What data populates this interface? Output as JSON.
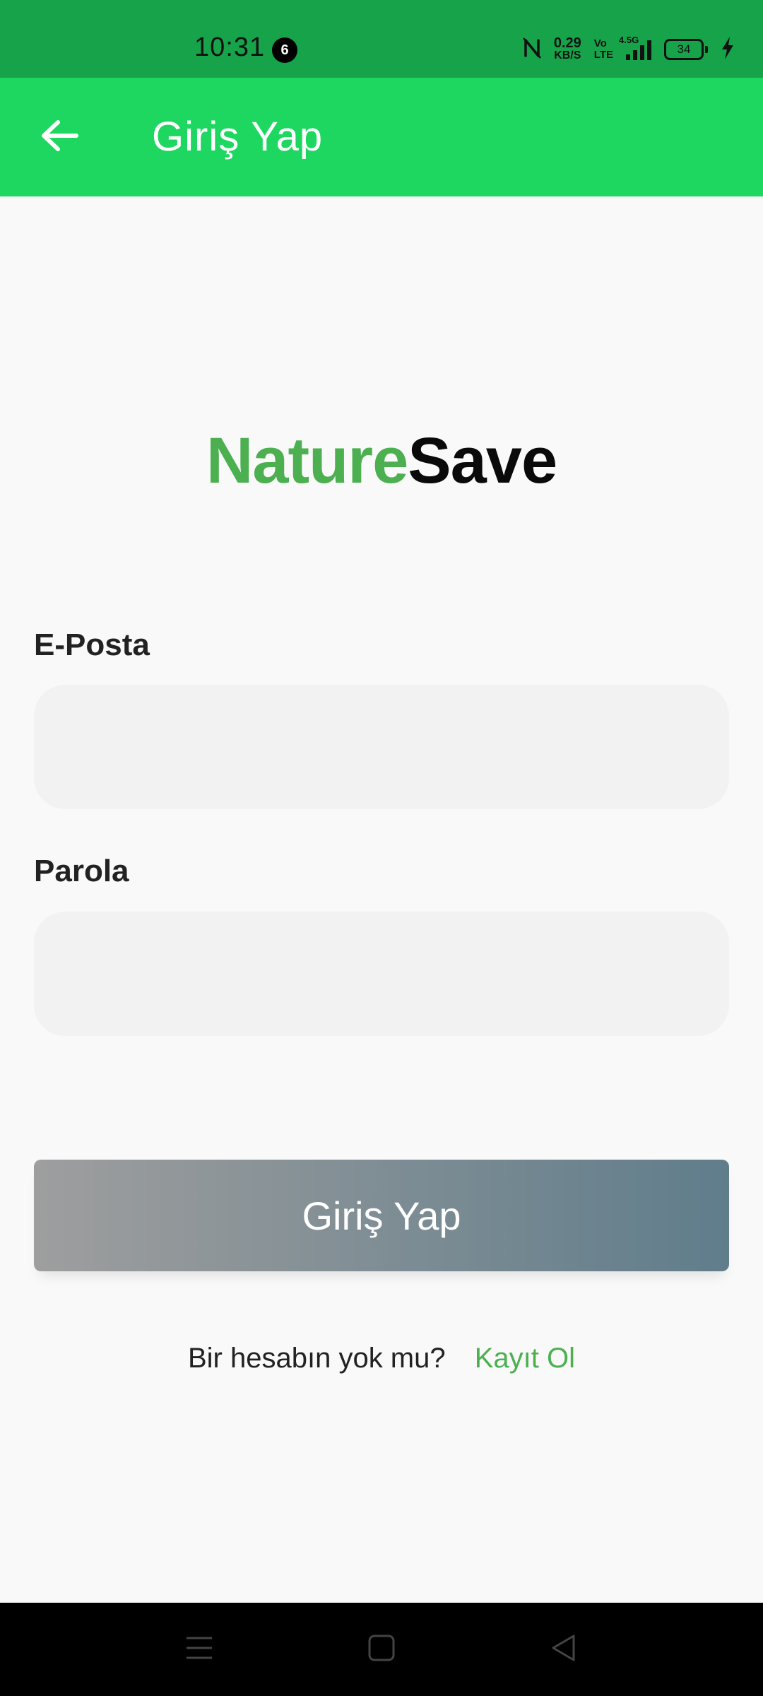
{
  "status_bar": {
    "time": "10:31",
    "notification_count": "6",
    "net_speed_value": "0.29",
    "net_speed_unit": "KB/S",
    "volte_top": "Vo",
    "volte_bottom": "LTE",
    "network_type": "4.5G",
    "battery_level": "34"
  },
  "app_bar": {
    "title": "Giriş Yap"
  },
  "logo": {
    "part1": "Nature",
    "part2": "Save"
  },
  "form": {
    "email_label": "E-Posta",
    "email_value": "",
    "password_label": "Parola",
    "password_value": "",
    "submit_label": "Giriş Yap"
  },
  "signup": {
    "question": "Bir hesabın yok mu?",
    "link": "Kayıt Ol"
  },
  "colors": {
    "status_bar_bg": "#16a34a",
    "app_bar_bg": "#1ed760",
    "brand_green": "#4caf50",
    "button_gradient_start": "#9e9e9e",
    "button_gradient_end": "#607d8b"
  }
}
